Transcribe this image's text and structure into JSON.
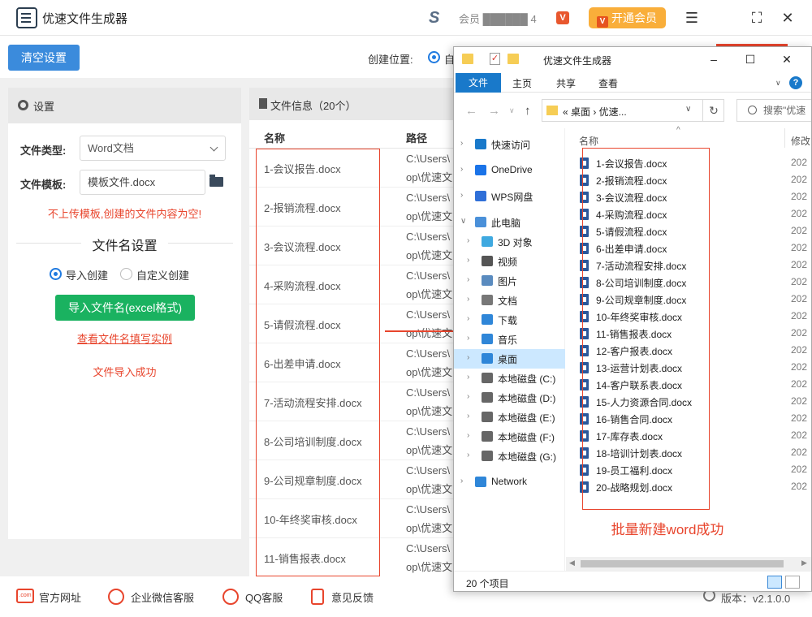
{
  "app": {
    "title": "优速文件生成器",
    "user_name": "会员 ██████ 4",
    "vip_badge": "V",
    "vip_button": "开通会员",
    "vip_icon": "V",
    "menu_icon": "☰",
    "max_icon": "⛶",
    "close_icon": "✕"
  },
  "toolbar": {
    "clear_label": "清空设置",
    "create_loc_label": "创建位置:",
    "create_loc_option": "自"
  },
  "settings": {
    "title": "设置",
    "file_type_label": "文件类型:",
    "file_type_value": "Word文档",
    "template_label": "文件模板:",
    "template_value": "模板文件.docx",
    "warning": "不上传模板,创建的文件内容为空!",
    "section_title": "文件名设置",
    "radio_import": "导入创建",
    "radio_custom": "自定义创建",
    "import_button": "导入文件名(excel格式)",
    "example_link": "查看文件名填写实例",
    "success": "文件导入成功"
  },
  "file_info": {
    "title": "文件信息（20个）",
    "col_name": "名称",
    "col_path": "路径",
    "rows": [
      {
        "name": "1-会议报告.docx",
        "path1": "C:\\Users\\",
        "path2": "op\\优速文"
      },
      {
        "name": "2-报销流程.docx",
        "path1": "C:\\Users\\",
        "path2": "op\\优速文"
      },
      {
        "name": "3-会议流程.docx",
        "path1": "C:\\Users\\",
        "path2": "op\\优速文"
      },
      {
        "name": "4-采购流程.docx",
        "path1": "C:\\Users\\",
        "path2": "op\\优速文"
      },
      {
        "name": "5-请假流程.docx",
        "path1": "C:\\Users\\",
        "path2": "op\\优速文"
      },
      {
        "name": "6-出差申请.docx",
        "path1": "C:\\Users\\",
        "path2": "op\\优速文"
      },
      {
        "name": "7-活动流程安排.docx",
        "path1": "C:\\Users\\",
        "path2": "op\\优速文"
      },
      {
        "name": "8-公司培训制度.docx",
        "path1": "C:\\Users\\",
        "path2": "op\\优速文"
      },
      {
        "name": "9-公司规章制度.docx",
        "path1": "C:\\Users\\",
        "path2": "op\\优速文"
      },
      {
        "name": "10-年终奖审核.docx",
        "path1": "C:\\Users\\",
        "path2": "op\\优速文"
      },
      {
        "name": "11-销售报表.docx",
        "path1": "C:\\Users\\",
        "path2": "op\\优速文"
      }
    ]
  },
  "bottom": {
    "website": "官方网址",
    "wechat": "企业微信客服",
    "qq": "QQ客服",
    "feedback": "意见反馈",
    "version": "版本：v2.1.0.0",
    "com_icon_text": ".com"
  },
  "explorer": {
    "title": "优速文件生成器",
    "check_icon": "✓",
    "tab_file": "文件",
    "tab_home": "主页",
    "tab_share": "共享",
    "tab_view": "查看",
    "help": "?",
    "address": "« 桌面 › 优速...",
    "search_placeholder": "搜索\"优速",
    "nav": [
      {
        "label": "快速访问",
        "icon": "star-icon",
        "color": "#1979ca"
      },
      {
        "label": "OneDrive",
        "icon": "cloud-icon",
        "color": "#1a73e8"
      },
      {
        "label": "WPS网盘",
        "icon": "wps-cloud-icon",
        "color": "#2f6fd8"
      },
      {
        "label": "此电脑",
        "icon": "computer-icon",
        "color": "#4a90d9"
      },
      {
        "label": "3D 对象",
        "icon": "cube-icon",
        "color": "#3fa9e0"
      },
      {
        "label": "视频",
        "icon": "video-icon",
        "color": "#555555"
      },
      {
        "label": "图片",
        "icon": "picture-icon",
        "color": "#5a8bbf"
      },
      {
        "label": "文档",
        "icon": "document-icon",
        "color": "#777777"
      },
      {
        "label": "下载",
        "icon": "download-icon",
        "color": "#2f86d8"
      },
      {
        "label": "音乐",
        "icon": "music-icon",
        "color": "#2f86d8"
      },
      {
        "label": "桌面",
        "icon": "desktop-icon",
        "color": "#2f86d8"
      },
      {
        "label": "本地磁盘 (C:)",
        "icon": "drive-icon",
        "color": "#666666"
      },
      {
        "label": "本地磁盘 (D:)",
        "icon": "drive-icon",
        "color": "#666666"
      },
      {
        "label": "本地磁盘 (E:)",
        "icon": "drive-icon",
        "color": "#666666"
      },
      {
        "label": "本地磁盘 (F:)",
        "icon": "drive-icon",
        "color": "#666666"
      },
      {
        "label": "本地磁盘 (G:)",
        "icon": "drive-icon",
        "color": "#666666"
      },
      {
        "label": "Network",
        "icon": "network-icon",
        "color": "#2f86d8"
      }
    ],
    "list_head_name": "名称",
    "list_head_modified": "修改",
    "files": [
      "1-会议报告.docx",
      "2-报销流程.docx",
      "3-会议流程.docx",
      "4-采购流程.docx",
      "5-请假流程.docx",
      "6-出差申请.docx",
      "7-活动流程安排.docx",
      "8-公司培训制度.docx",
      "9-公司规章制度.docx",
      "10-年终奖审核.docx",
      "11-销售报表.docx",
      "12-客户报表.docx",
      "13-运营计划表.docx",
      "14-客户联系表.docx",
      "15-人力资源合同.docx",
      "16-销售合同.docx",
      "17-库存表.docx",
      "18-培训计划表.docx",
      "19-员工福利.docx",
      "20-战略规划.docx"
    ],
    "date_prefix": "202",
    "success_note": "批量新建word成功",
    "status": "20 个项目"
  },
  "colors": {
    "accent": "#3b8bdc",
    "green": "#1ab260",
    "red": "#e8452d",
    "vip": "#f9ae3a"
  }
}
